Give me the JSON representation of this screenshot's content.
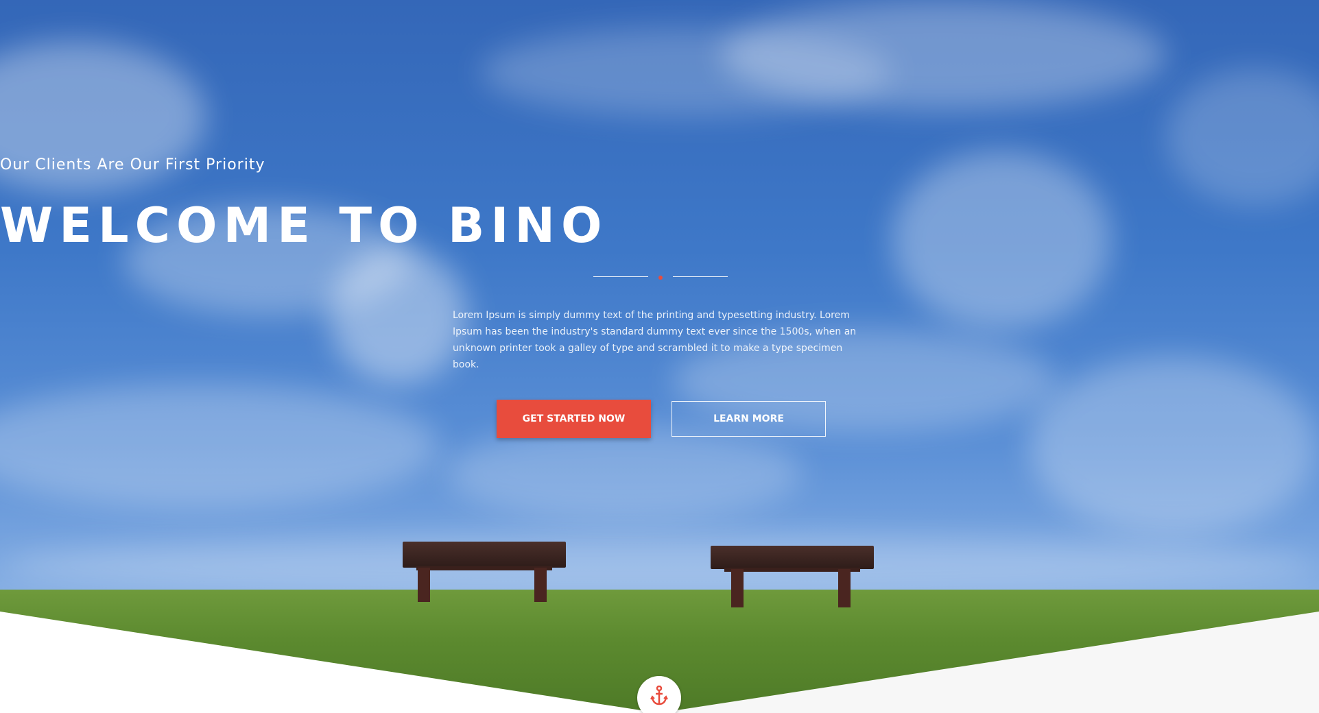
{
  "hero": {
    "subtitle": "Our Clients Are Our First Priority",
    "title": "WELCOME TO BINO",
    "description": "Lorem Ipsum is simply dummy text of the printing and typesetting industry. Lorem Ipsum has been the industry's standard dummy text ever since the 1500s, when an unknown printer took a galley of type and scrambled it to make a type specimen book.",
    "primary_button": "GET STARTED NOW",
    "secondary_button": "LEARN MORE",
    "scroll_icon": "anchor-icon"
  },
  "colors": {
    "accent": "#e84c3d",
    "sky": "#3e78c8",
    "grass": "#5c8a2f",
    "white": "#ffffff"
  }
}
